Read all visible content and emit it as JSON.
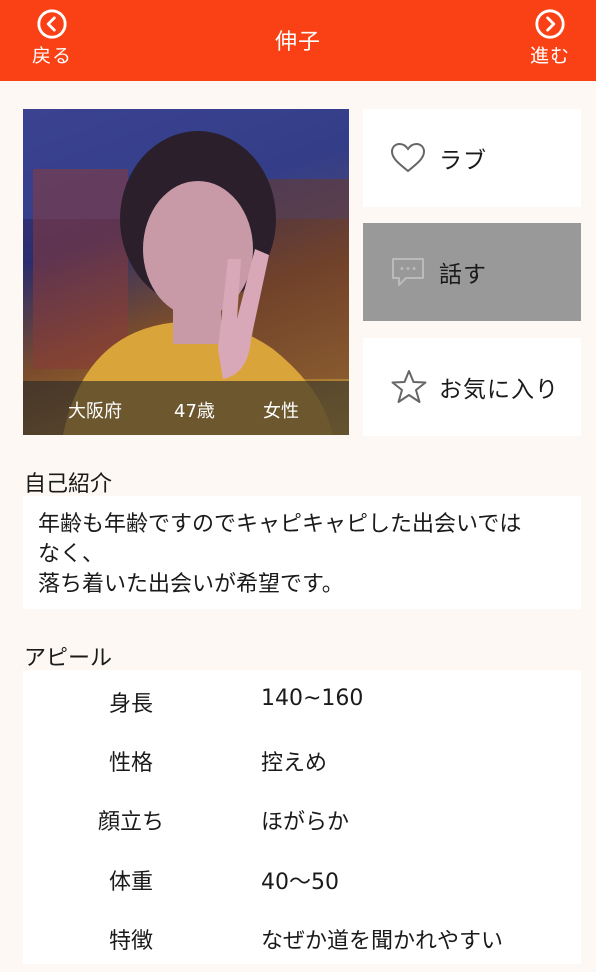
{
  "header": {
    "title": "伸子",
    "back_label": "戻る",
    "forward_label": "進む",
    "bg_color": "#fa4116"
  },
  "profile": {
    "location": "大阪府",
    "age": "47歳",
    "gender": "女性"
  },
  "actions": {
    "love_label": "ラブ",
    "talk_label": "話す",
    "favorite_label": "お気に入り",
    "love_icon": "heart-icon",
    "talk_icon": "chat-bubble-icon",
    "favorite_icon": "star-icon"
  },
  "intro": {
    "heading": "自己紹介",
    "text": "年齢も年齢ですのでキャピキャピした出会いでは\nなく、\n落ち着いた出会いが希望です。"
  },
  "appeal": {
    "heading": "アピール",
    "rows": [
      {
        "key": "身長",
        "value": "140~160"
      },
      {
        "key": "性格",
        "value": "控えめ"
      },
      {
        "key": "顔立ち",
        "value": "ほがらか"
      },
      {
        "key": "体重",
        "value": "40〜50"
      },
      {
        "key": "特徴",
        "value": "なぜか道を聞かれやすい"
      }
    ]
  }
}
